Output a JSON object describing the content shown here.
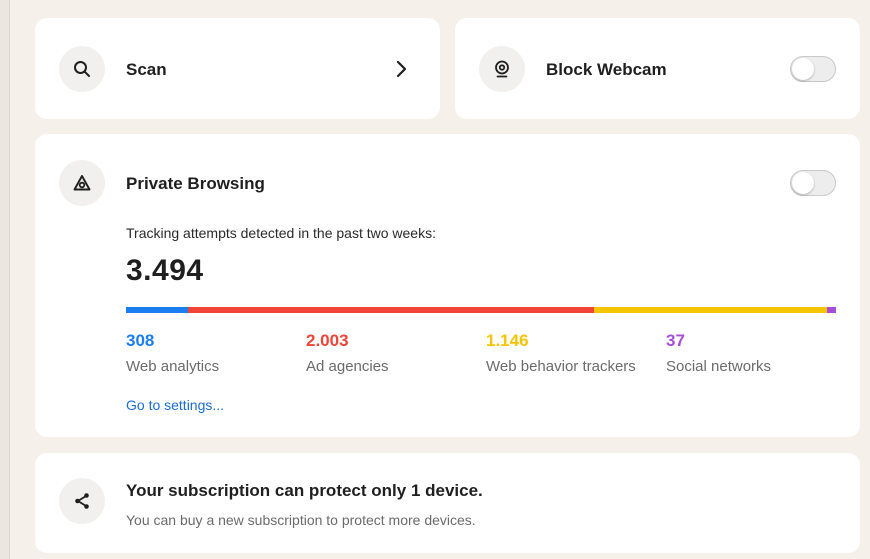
{
  "scan": {
    "label": "Scan"
  },
  "webcam": {
    "label": "Block Webcam",
    "enabled": false
  },
  "private_browsing": {
    "label": "Private Browsing",
    "enabled": false,
    "tracking_text": "Tracking attempts detected in the past two weeks:",
    "total": "3.494",
    "categories": [
      {
        "value": "308",
        "label": "Web analytics",
        "color": "#1a7ef0"
      },
      {
        "value": "2.003",
        "label": "Ad agencies",
        "color": "#f04438"
      },
      {
        "value": "1.146",
        "label": "Web behavior trackers",
        "color": "#f5c400"
      },
      {
        "value": "37",
        "label": "Social networks",
        "color": "#a64ddb"
      }
    ],
    "settings_link": "Go to settings..."
  },
  "subscription": {
    "title": "Your subscription can protect only 1 device.",
    "description": "You can buy a new subscription to protect more devices."
  }
}
